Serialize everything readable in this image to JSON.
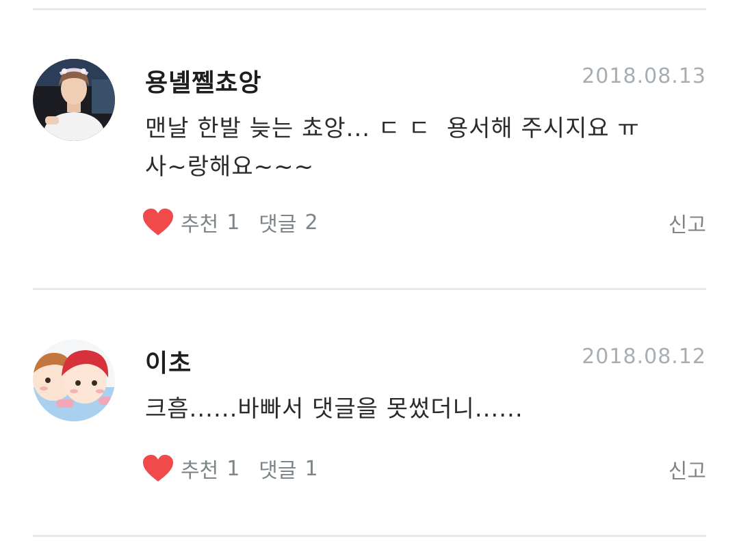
{
  "comments": [
    {
      "username": "용녤쩰쵸앙",
      "date": "2018.08.13",
      "text": "맨날 한발 늦는 쵸앙... ㄷ ㄷ  용서해 주시지요 ㅠ\n사~랑해요~~~",
      "like_label": "추천",
      "like_count": "1",
      "reply_label": "댓글",
      "reply_count": "2",
      "report_label": "신고",
      "avatar_icon": "avatar-photo-icon"
    },
    {
      "username": "이초",
      "date": "2018.08.12",
      "text": "크흠......바빠서 댓글을 못썼더니......",
      "like_label": "추천",
      "like_count": "1",
      "reply_label": "댓글",
      "reply_count": "1",
      "report_label": "신고",
      "avatar_icon": "avatar-illustration-icon"
    }
  ],
  "colors": {
    "heart": "#f04a4a",
    "date": "#a6aeb3",
    "meta": "#7d8589",
    "divider": "#e4e9ec"
  }
}
